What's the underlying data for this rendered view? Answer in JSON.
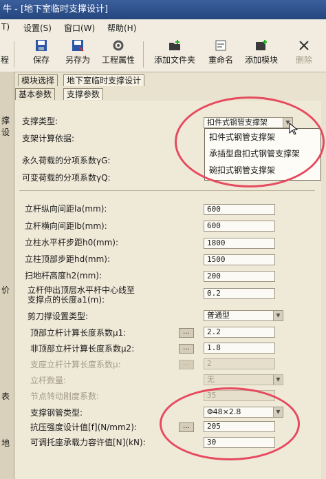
{
  "window": {
    "title": "牛 - [地下室临时支撑设计]"
  },
  "menu": {
    "items": [
      "T)",
      "设置(S)",
      "窗口(W)",
      "帮助(H)"
    ]
  },
  "toolbar": {
    "left_label": "程",
    "save": "保存",
    "save_as": "另存为",
    "project_props": "工程属性",
    "add_folder": "添加文件夹",
    "rename": "重命名",
    "add_module": "添加模块",
    "delete": "删除"
  },
  "tabs": {
    "module_select": "模块选择",
    "module_current": "地下室临时支撑设计",
    "basic_params": "基本参数",
    "support_params": "支撑参数"
  },
  "left": {
    "label1": "撑设",
    "label2": "价",
    "label3": "表",
    "label4": "地"
  },
  "form": {
    "support_type_label": "支撑类型:",
    "support_type_value": "扣件式钢管支撑架",
    "calc_basis_label": "支架计算依据:",
    "dead_load_label": "永久荷载的分项系数γG:",
    "live_load_label": "可变荷载的分项系数γQ:",
    "la_label": "立杆纵向间距la(mm):",
    "la_value": "600",
    "lb_label": "立杆横向间距lb(mm):",
    "lb_value": "600",
    "h0_label": "立柱水平杆步距h0(mm):",
    "h0_value": "1800",
    "hd_label": "立柱顶部步距hd(mm):",
    "hd_value": "1500",
    "h2_label": "扫地杆高度h2(mm):",
    "h2_value": "200",
    "a1_label_line1": "立杆伸出顶层水平杆中心线至",
    "a1_label_line2": "支撑点的长度a1(m):",
    "a1_value": "0.2",
    "brace_label": "剪刀撑设置类型:",
    "brace_value": "普通型",
    "mu1_label": "顶部立杆计算长度系数μ1:",
    "mu1_value": "2.2",
    "mu2_label": "非顶部立杆计算长度系数μ2:",
    "mu2_value": "1.8",
    "dim1_label": "支座立杆计算长度系数μ:",
    "dim1_value": "2",
    "dim2_label": "立杆数量:",
    "dim2_value": "无",
    "dim3_label": "节点转动刚度系数:",
    "dim3_value": "35",
    "pipe_label": "支撑钢管类型:",
    "pipe_value": "Φ48×2.8",
    "f_label": "抗压强度设计值[f](N/mm2):",
    "f_value": "205",
    "n_label": "可调托座承载力容许值[N](kN):",
    "n_value": "30"
  },
  "dropdown": {
    "options": [
      "扣件式钢管支撑架",
      "承插型盘扣式钢管支撑架",
      "碗扣式钢管支撑架"
    ]
  },
  "colors": {
    "title_bar": "#2d5290",
    "annotation": "#e64a5e",
    "panel": "#efe9d8"
  }
}
